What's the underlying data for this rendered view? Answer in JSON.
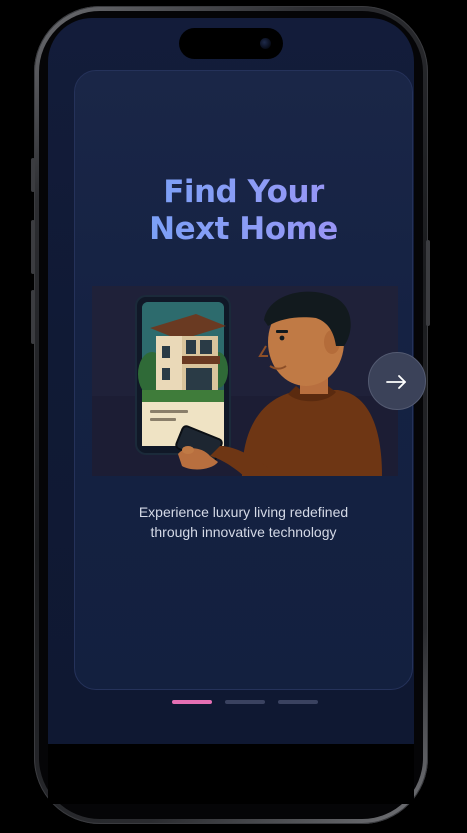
{
  "onboarding": {
    "title_line1": "Find Your",
    "title_line2": "Next Home",
    "subtitle_line1": "Experience luxury living redefined",
    "subtitle_line2": "through innovative technology",
    "next_icon": "arrow-right-icon",
    "illustration_icon": "person-with-phone-house-illustration",
    "pagination": {
      "total": 3,
      "active_index": 0
    }
  },
  "colors": {
    "background": "#111a36",
    "card": "#172445",
    "title_gradient_start": "#6fa2f5",
    "title_gradient_end": "#a48df4",
    "active_dot": "#e46fb3",
    "inactive_dot": "#3a4260",
    "next_button": "#3b4259"
  }
}
